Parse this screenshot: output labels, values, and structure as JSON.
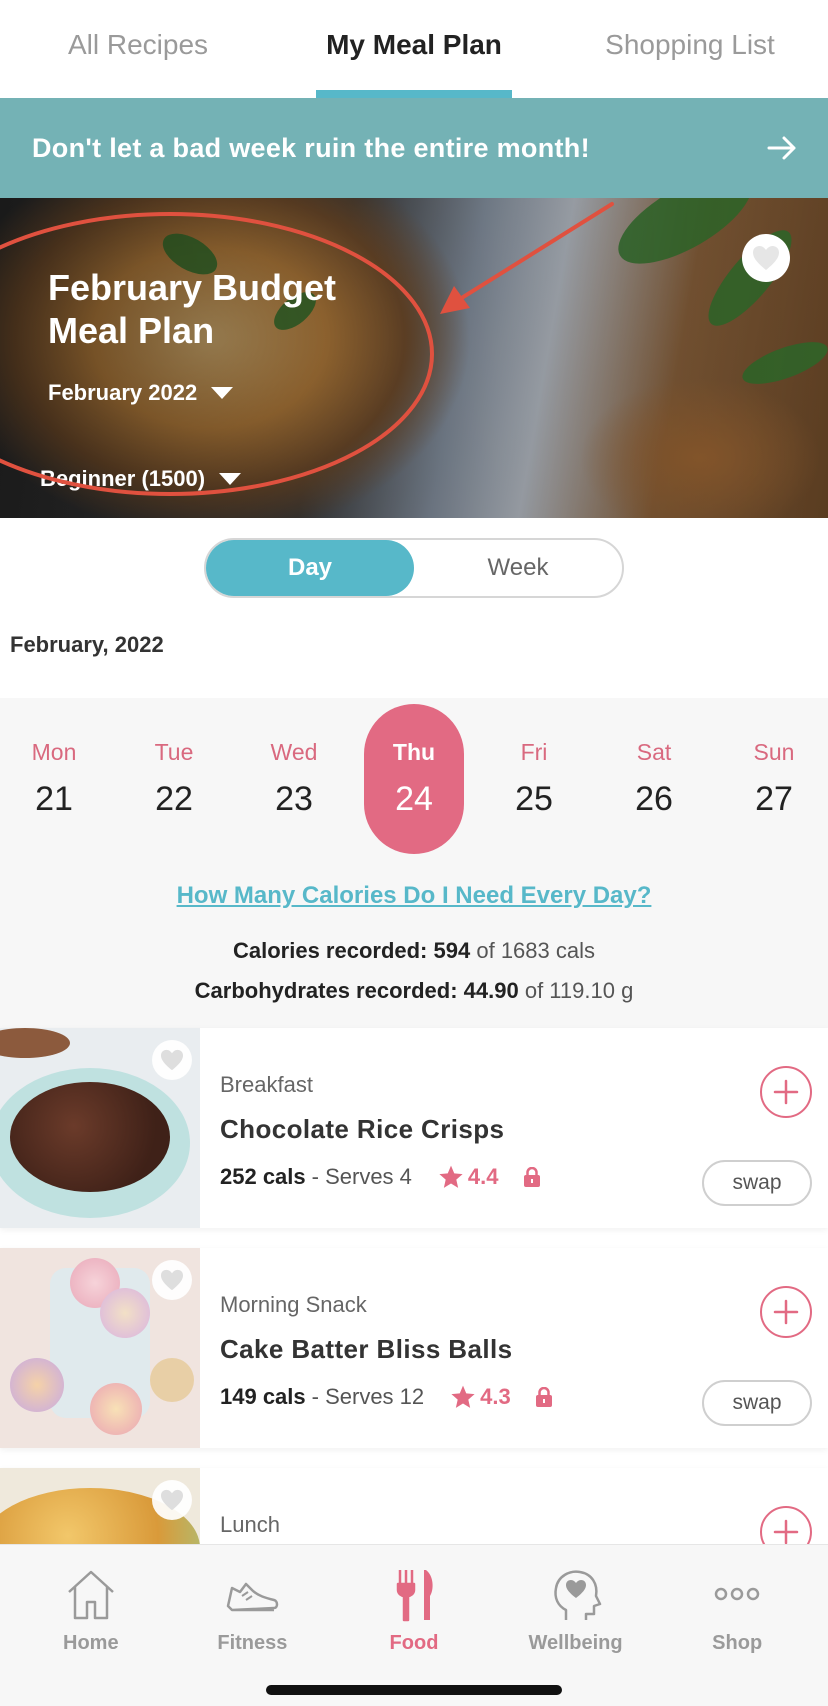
{
  "tabs": [
    {
      "label": "All Recipes",
      "active": false
    },
    {
      "label": "My Meal Plan",
      "active": true
    },
    {
      "label": "Shopping List",
      "active": false
    }
  ],
  "banner": {
    "text": "Don't let a bad week ruin the entire month!",
    "icon": "arrow-right-icon"
  },
  "hero": {
    "title": "February Budget Meal Plan",
    "month_select": "February 2022",
    "level_select": "Beginner (1500)"
  },
  "view_toggle": {
    "day_label": "Day",
    "week_label": "Week",
    "selected": "Day"
  },
  "calendar": {
    "month_label": "February, 2022",
    "days": [
      {
        "name": "Mon",
        "num": "21"
      },
      {
        "name": "Tue",
        "num": "22"
      },
      {
        "name": "Wed",
        "num": "23"
      },
      {
        "name": "Thu",
        "num": "24"
      },
      {
        "name": "Fri",
        "num": "25"
      },
      {
        "name": "Sat",
        "num": "26"
      },
      {
        "name": "Sun",
        "num": "27"
      }
    ],
    "selected_day": "Thu"
  },
  "calories_link": "How Many Calories Do I Need Every Day?",
  "stats": {
    "calories_label": "Calories recorded:",
    "calories_value": "594",
    "calories_total": "of 1683 cals",
    "carbs_label": "Carbohydrates recorded:",
    "carbs_value": "44.90",
    "carbs_total": "of 119.10 g"
  },
  "meals": [
    {
      "type": "Breakfast",
      "name": "Chocolate Rice Crisps",
      "cals": "252 cals",
      "serves": "- Serves 4",
      "rating": "4.4",
      "swap_label": "swap"
    },
    {
      "type": "Morning Snack",
      "name": "Cake Batter Bliss Balls",
      "cals": "149 cals",
      "serves": "- Serves 12",
      "rating": "4.3",
      "swap_label": "swap"
    },
    {
      "type": "Lunch"
    }
  ],
  "bottom_nav": [
    {
      "label": "Home",
      "icon": "home-icon",
      "active": false
    },
    {
      "label": "Fitness",
      "icon": "shoe-icon",
      "active": false
    },
    {
      "label": "Food",
      "icon": "fork-knife-icon",
      "active": true
    },
    {
      "label": "Wellbeing",
      "icon": "head-heart-icon",
      "active": false
    },
    {
      "label": "Shop",
      "icon": "more-dots-icon",
      "active": false
    }
  ],
  "colors": {
    "teal": "#57b8c9",
    "banner": "#74b2b5",
    "pink": "#e26a83",
    "annotation_red": "#e0513f"
  }
}
